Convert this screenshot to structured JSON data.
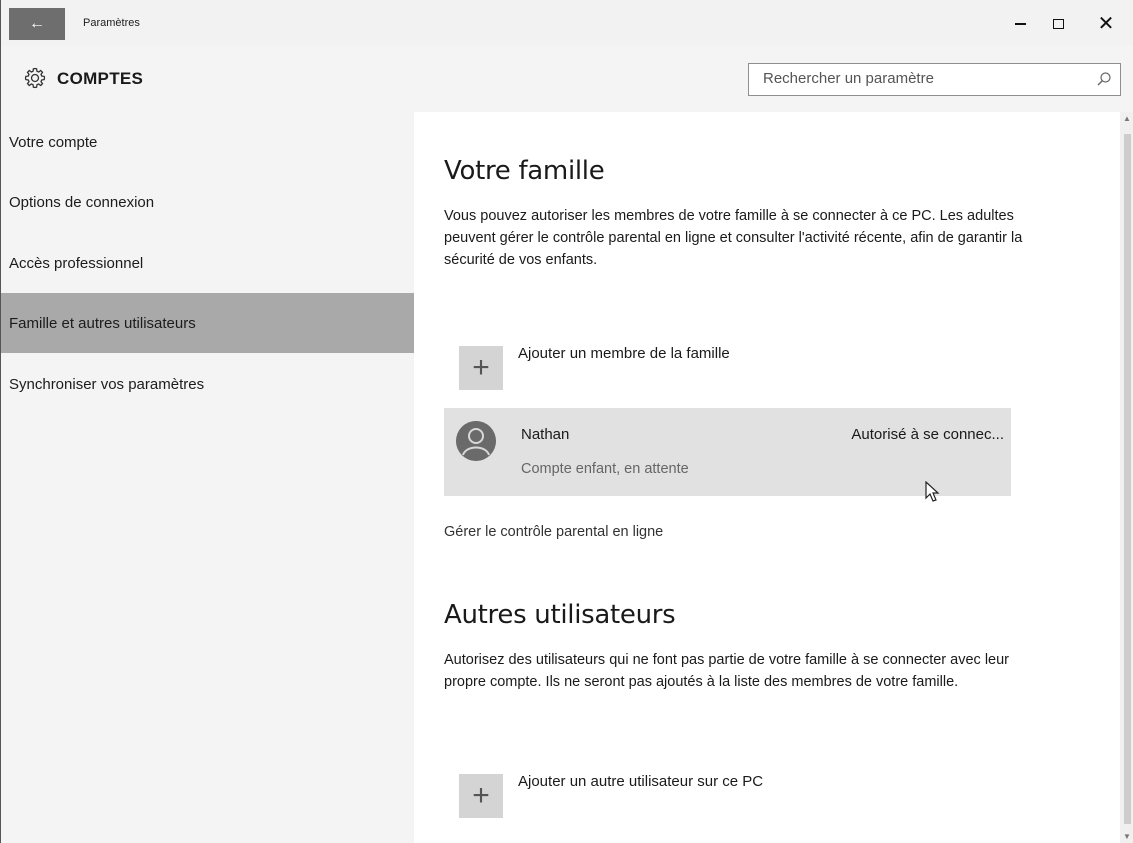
{
  "window": {
    "title": "Paramètres",
    "back_icon": "←",
    "minimize_icon": "minimize-icon",
    "maximize_icon": "maximize-icon",
    "close_icon": "✕"
  },
  "header": {
    "section_title": "COMPTES",
    "section_icon": "gear-icon",
    "search_placeholder": "Rechercher un paramètre",
    "search_icon": "search-icon"
  },
  "sidebar": {
    "items": [
      {
        "label": "Votre compte",
        "active": false
      },
      {
        "label": "Options de connexion",
        "active": false
      },
      {
        "label": "Accès professionnel",
        "active": false
      },
      {
        "label": "Famille et autres utilisateurs",
        "active": true
      },
      {
        "label": "Synchroniser vos paramètres",
        "active": false
      }
    ]
  },
  "family": {
    "heading": "Votre famille",
    "description": "Vous pouvez autoriser les membres de votre famille à se connecter à ce PC. Les adultes peuvent gérer le contrôle parental en ligne et consulter l'activité récente, afin de garantir la sécurité de vos enfants.",
    "add_label": "Ajouter un membre de la famille",
    "add_icon": "+",
    "member": {
      "name": "Nathan",
      "status": "Compte enfant, en attente",
      "right_text": "Autorisé à se connec...",
      "avatar_icon": "user-avatar-icon"
    },
    "manage_link": "Gérer le contrôle parental en ligne"
  },
  "others": {
    "heading": "Autres utilisateurs",
    "description": "Autorisez des utilisateurs qui ne font pas partie de votre famille à se connecter avec leur propre compte. Ils ne seront pas ajoutés à la liste des membres de votre famille.",
    "add_label": "Ajouter un autre utilisateur sur ce PC",
    "add_icon": "+"
  },
  "colors": {
    "sidebar_active": "#a9a9a9",
    "member_row": "#e1e1e1",
    "back_button": "#6e6e6e"
  }
}
